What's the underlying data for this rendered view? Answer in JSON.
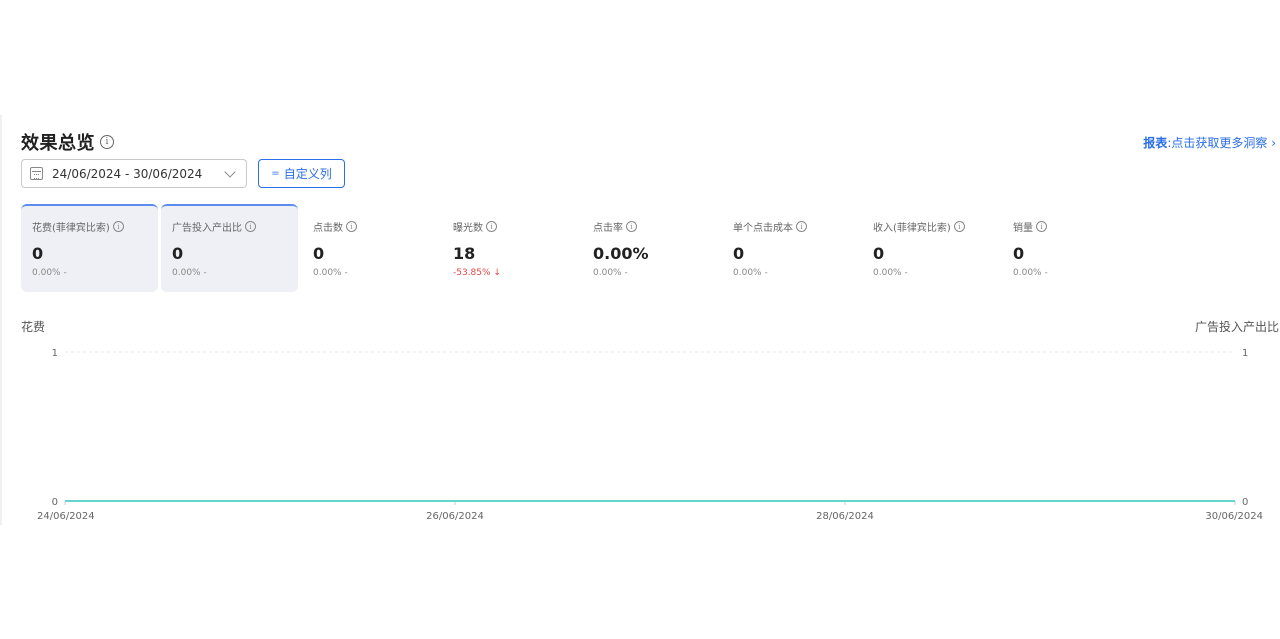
{
  "header": {
    "title": "效果总览",
    "info_icon": "info-circle-icon",
    "report_link_bold": "报表",
    "report_link_rest": ":点击获取更多洞察",
    "report_link_arrow": "›"
  },
  "toolbar": {
    "date_range": "24/06/2024 - 30/06/2024",
    "custom_columns_label": "自定义列",
    "custom_columns_icon": "="
  },
  "metrics": [
    {
      "label": "花费(菲律宾比索)",
      "value": "0",
      "change": "0.00% -",
      "selected": true
    },
    {
      "label": "广告投入产出比",
      "value": "0",
      "change": "0.00% -",
      "selected": true
    },
    {
      "label": "点击数",
      "value": "0",
      "change": "0.00% -",
      "selected": false
    },
    {
      "label": "曝光数",
      "value": "18",
      "change": "-53.85% ↓",
      "selected": false,
      "negative": true
    },
    {
      "label": "点击率",
      "value": "0.00%",
      "change": "0.00% -",
      "selected": false
    },
    {
      "label": "单个点击成本",
      "value": "0",
      "change": "0.00% -",
      "selected": false
    },
    {
      "label": "收入(菲律宾比索)",
      "value": "0",
      "change": "0.00% -",
      "selected": false
    },
    {
      "label": "销量",
      "value": "0",
      "change": "0.00% -",
      "selected": false
    }
  ],
  "chart_data": {
    "type": "line",
    "left_axis_label": "花费",
    "right_axis_label": "广告投入产出比",
    "x_ticks": [
      "24/06/2024",
      "26/06/2024",
      "28/06/2024",
      "30/06/2024"
    ],
    "y_left_ticks": [
      "0",
      "1"
    ],
    "y_right_ticks": [
      "0",
      "1"
    ],
    "ylim": [
      0,
      1
    ],
    "series_color": "#62d6cc",
    "series": [
      {
        "values": [
          0,
          0,
          0,
          0,
          0,
          0,
          0
        ]
      },
      {
        "values": [
          0,
          0,
          0,
          0,
          0,
          0,
          0
        ]
      }
    ]
  }
}
